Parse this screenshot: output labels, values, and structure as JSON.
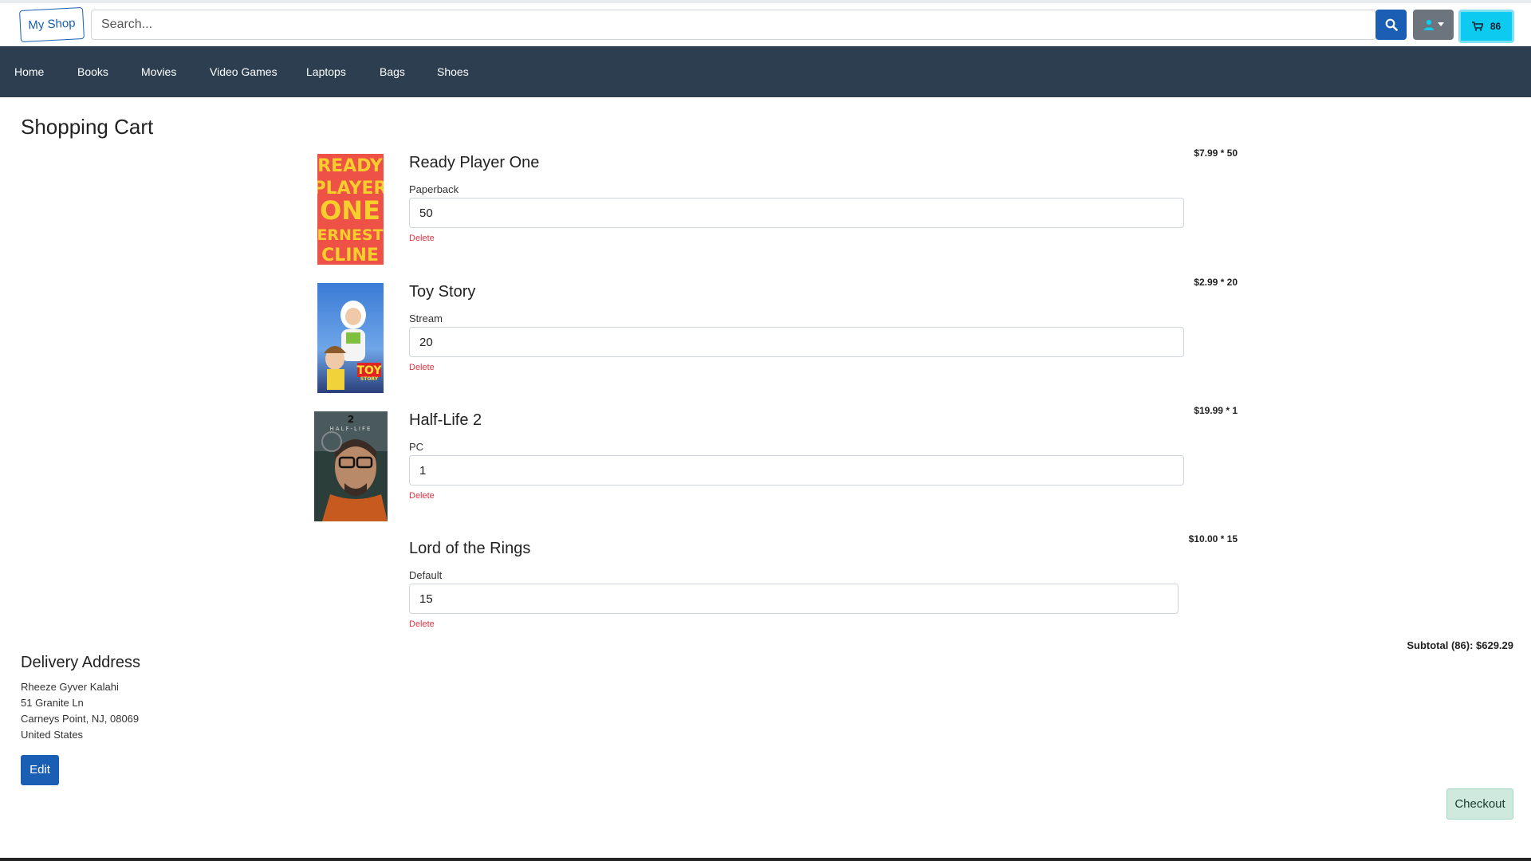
{
  "header": {
    "brand": "My Shop",
    "search_placeholder": "Search...",
    "cart_count": "86",
    "colors": {
      "primary": "#1a5fb4",
      "secondary": "#6c757d",
      "info": "#0dcaf0"
    }
  },
  "nav": {
    "items": [
      "Home",
      "Books",
      "Movies",
      "Video Games",
      "Laptops",
      "Bags",
      "Shoes"
    ],
    "background": "#2c3e50"
  },
  "page": {
    "title": "Shopping Cart"
  },
  "cart": {
    "items": [
      {
        "title": "Ready Player One",
        "variant": "Paperback",
        "quantity": "50",
        "price": "$7.99 * 50",
        "delete_label": "Delete",
        "thumb_icon": "book-cover-icon",
        "cover_text": [
          "READY",
          "PLAYER",
          "ONE",
          "ERNEST",
          "CLINE"
        ]
      },
      {
        "title": "Toy Story",
        "variant": "Stream",
        "quantity": "20",
        "price": "$2.99 * 20",
        "delete_label": "Delete",
        "thumb_icon": "movie-poster-icon",
        "cover_text": [
          "TOY",
          "STORY"
        ]
      },
      {
        "title": "Half-Life 2",
        "variant": "PC",
        "quantity": "1",
        "price": "$19.99 * 1",
        "delete_label": "Delete",
        "thumb_icon": "game-cover-icon",
        "cover_text": [
          "HALF-LIFE",
          "2"
        ]
      },
      {
        "title": "Lord of the Rings",
        "variant": "Default",
        "quantity": "15",
        "price": "$10.00 * 15",
        "delete_label": "Delete"
      }
    ],
    "subtotal": "Subtotal (86): $629.29"
  },
  "delivery": {
    "title": "Delivery Address",
    "lines": [
      "Rheeze Gyver Kalahi",
      "51 Granite Ln",
      "Carneys Point, NJ, 08069",
      "United States"
    ],
    "edit_label": "Edit"
  },
  "checkout_label": "Checkout"
}
